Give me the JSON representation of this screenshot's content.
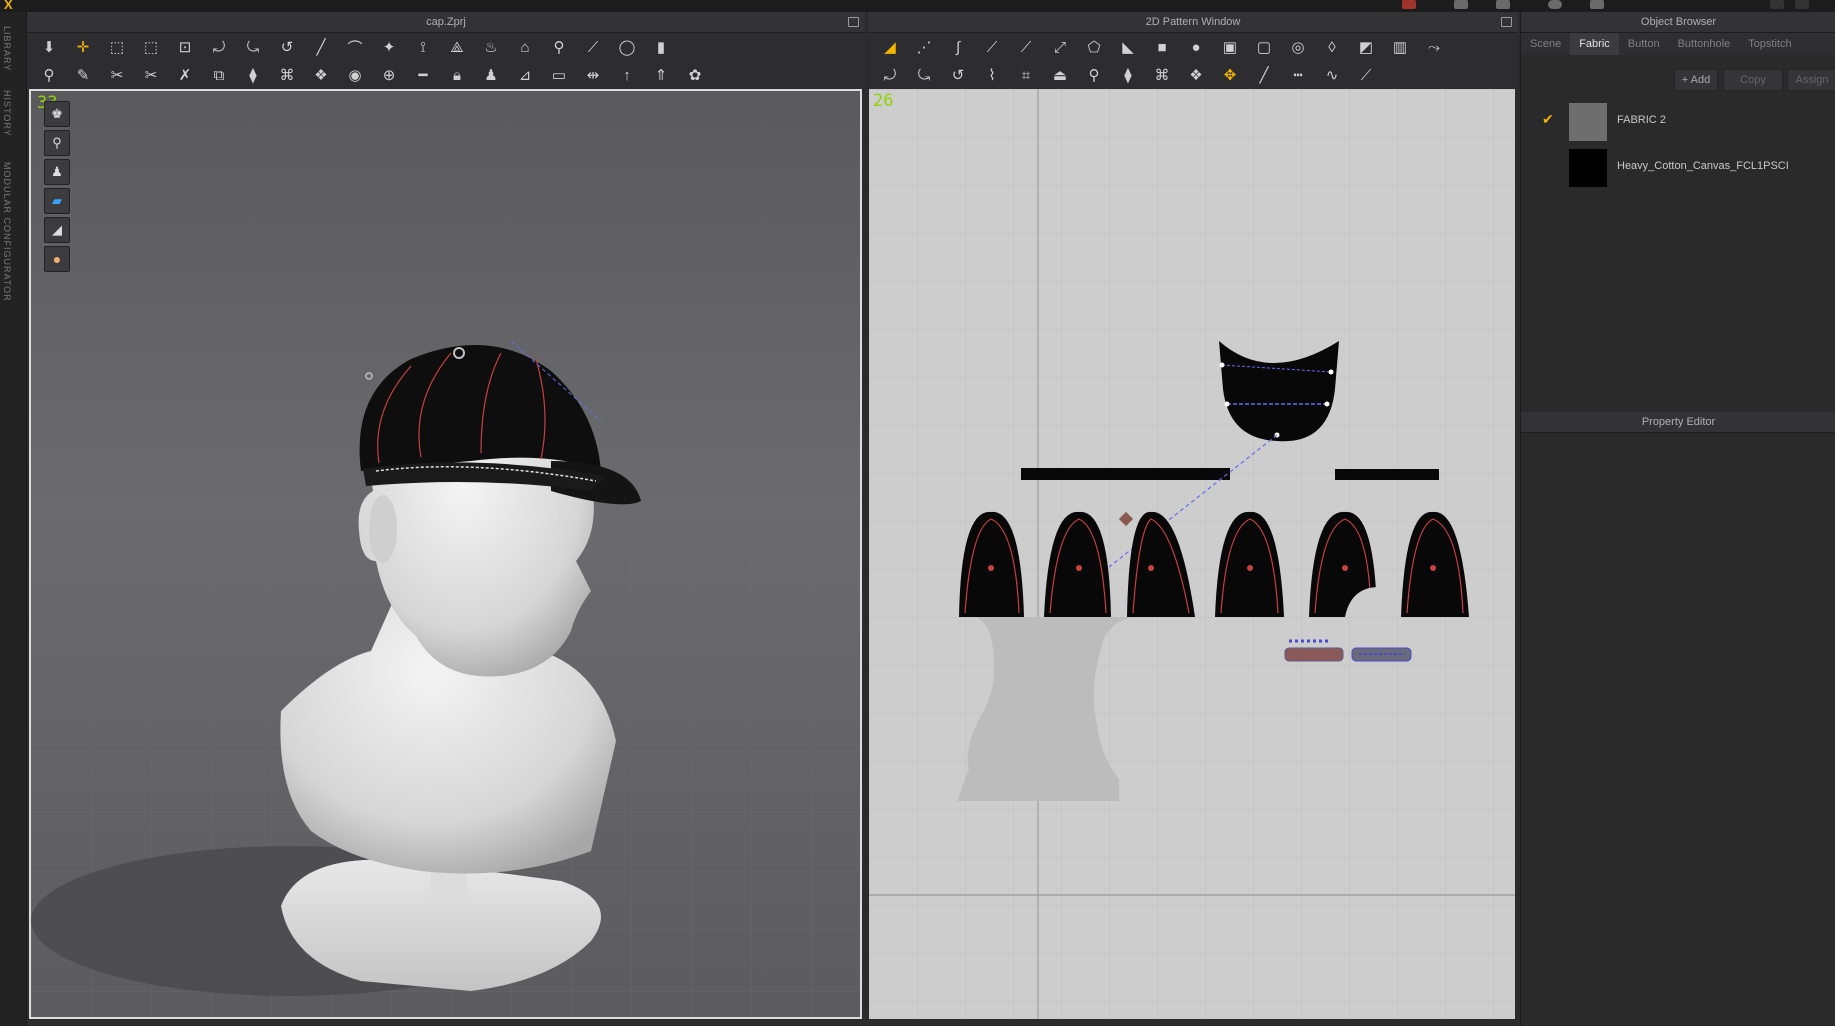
{
  "app": {
    "logo_text": "X"
  },
  "rail": {
    "items": [
      "LIBRARY",
      "HISTORY",
      "MODULAR CONFIGURATOR"
    ]
  },
  "view3d": {
    "title": "cap.Zprj",
    "fps": "33",
    "side_buttons": [
      "avatar-show-icon",
      "garment-show-icon",
      "avatar-pose-icon",
      "fabric-texture-icon",
      "surface-icon",
      "skin-icon"
    ]
  },
  "view2d": {
    "title": "2D Pattern Window",
    "fps": "26"
  },
  "object_browser": {
    "title": "Object Browser",
    "tabs": [
      "Scene",
      "Fabric",
      "Button",
      "Buttonhole",
      "Topstitch"
    ],
    "active_tab": "Fabric",
    "buttons": {
      "add": "+ Add",
      "copy": "Copy",
      "assign": "Assign"
    },
    "fabrics": [
      {
        "name": "FABRIC 2",
        "swatch": "#6e6e6e",
        "checked": true
      },
      {
        "name": "Heavy_Cotton_Canvas_FCL1PSCI",
        "swatch": "#000000",
        "checked": false
      }
    ]
  },
  "property_editor": {
    "title": "Property Editor"
  },
  "colors": {
    "accent": "#f2b600",
    "fps": "#8fd400",
    "stitch": "#c84040",
    "selection": "#6a6af0"
  }
}
